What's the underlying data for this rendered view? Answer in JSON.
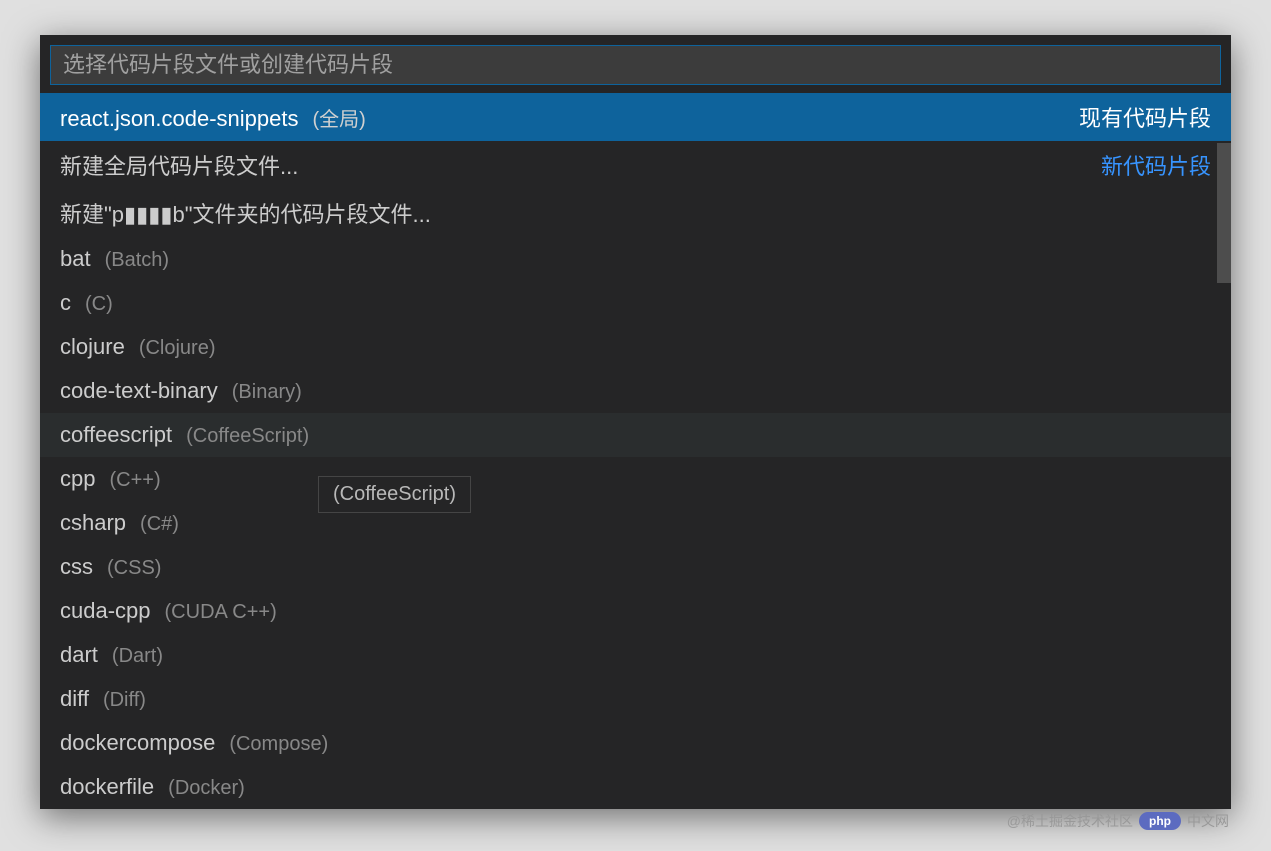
{
  "search": {
    "placeholder": "选择代码片段文件或创建代码片段"
  },
  "groups": {
    "existing": "现有代码片段",
    "new": "新代码片段"
  },
  "items": [
    {
      "name": "react.json.code-snippets",
      "desc": "(全局)",
      "group": "existing",
      "selected": true
    },
    {
      "name": "新建全局代码片段文件...",
      "desc": "",
      "group": "new"
    },
    {
      "name": "新建\"p▮▮▮▮b\"文件夹的代码片段文件...",
      "desc": ""
    },
    {
      "name": "bat",
      "desc": "(Batch)"
    },
    {
      "name": "c",
      "desc": "(C)"
    },
    {
      "name": "clojure",
      "desc": "(Clojure)"
    },
    {
      "name": "code-text-binary",
      "desc": "(Binary)"
    },
    {
      "name": "coffeescript",
      "desc": "(CoffeeScript)",
      "hovered": true
    },
    {
      "name": "cpp",
      "desc": "(C++)"
    },
    {
      "name": "csharp",
      "desc": "(C#)"
    },
    {
      "name": "css",
      "desc": "(CSS)"
    },
    {
      "name": "cuda-cpp",
      "desc": "(CUDA C++)"
    },
    {
      "name": "dart",
      "desc": "(Dart)"
    },
    {
      "name": "diff",
      "desc": "(Diff)"
    },
    {
      "name": "dockercompose",
      "desc": "(Compose)"
    },
    {
      "name": "dockerfile",
      "desc": "(Docker)"
    }
  ],
  "tooltip": "(CoffeeScript)",
  "watermark": {
    "text1": "@稀土掘金技术社区",
    "php": "php",
    "text2": "中文网"
  }
}
